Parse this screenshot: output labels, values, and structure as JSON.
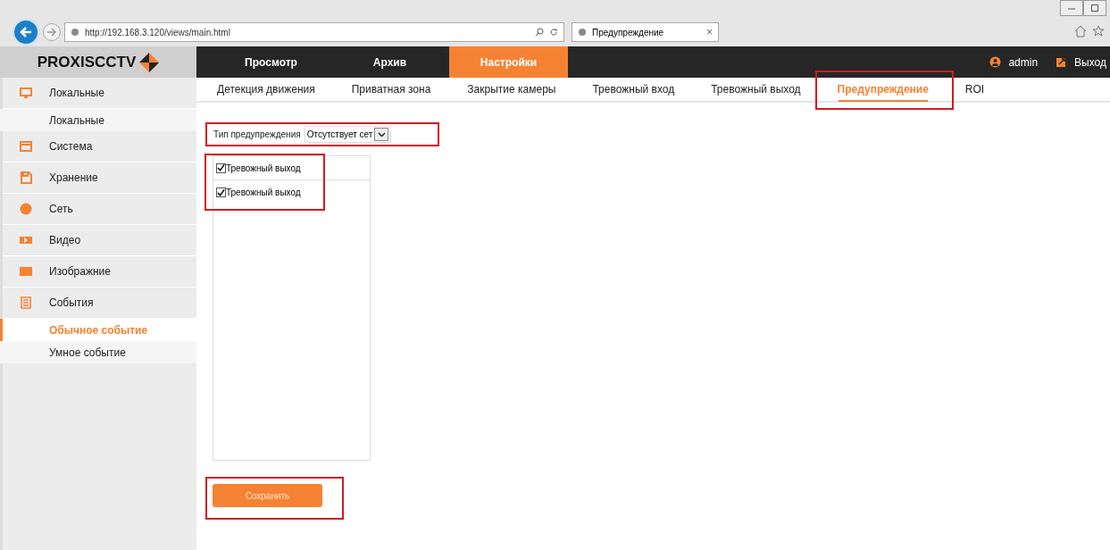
{
  "browser": {
    "url": "http://192.168.3.120/views/main.html",
    "tab_title": "Предупреждение",
    "tab_close": "×"
  },
  "header": {
    "logo": "PROXISCCTV",
    "nav": [
      {
        "label": "Просмотр",
        "selected": false
      },
      {
        "label": "Архив",
        "selected": false
      },
      {
        "label": "Настройки",
        "selected": true
      }
    ],
    "user": "admin",
    "logout": "Выход"
  },
  "subtabs": [
    {
      "label": "Детекция движения",
      "selected": false,
      "highlighted": false
    },
    {
      "label": "Приватная зона",
      "selected": false,
      "highlighted": false
    },
    {
      "label": "Закрытие камеры",
      "selected": false,
      "highlighted": false
    },
    {
      "label": "Тревожный вход",
      "selected": false,
      "highlighted": false
    },
    {
      "label": "Тревожный выход",
      "selected": false,
      "highlighted": false
    },
    {
      "label": "Предупреждение",
      "selected": true,
      "highlighted": true
    },
    {
      "label": "ROI",
      "selected": false,
      "highlighted": false
    }
  ],
  "sidebar": {
    "items": [
      {
        "label": "Локальные",
        "children": [
          {
            "label": "Локальные",
            "selected": false
          }
        ]
      },
      {
        "label": "Система"
      },
      {
        "label": "Хранение"
      },
      {
        "label": "Сеть"
      },
      {
        "label": "Видео"
      },
      {
        "label": "Изображние"
      },
      {
        "label": "События",
        "children": [
          {
            "label": "Обычное событие",
            "selected": true
          },
          {
            "label": "Умное событие",
            "selected": false
          }
        ]
      }
    ]
  },
  "alert_type": {
    "label": "Тип предупреждения",
    "value": "Отсутствует сет",
    "highlighted": true
  },
  "outputs": {
    "highlighted": true,
    "items": [
      {
        "label": "Тревожный выход",
        "checked": true
      },
      {
        "label": "Тревожный выход",
        "checked": true
      }
    ]
  },
  "save_button": {
    "label": "Сохранить",
    "highlighted": true
  }
}
